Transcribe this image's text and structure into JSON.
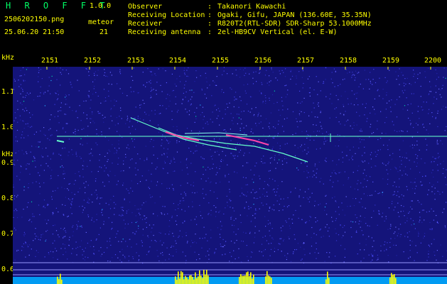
{
  "header": {
    "app_title": "H R O F F T",
    "app_version": "1.0.0",
    "filename": "2506202150.png",
    "datetime": "25.06.20 21:50",
    "meteor_label": "meteor",
    "meteor_count": "21"
  },
  "info": [
    {
      "key": "Observer",
      "value": "Takanori Kawachi"
    },
    {
      "key": "Receiving Location",
      "value": "Ogaki, Gifu, JAPAN (136.60E, 35.35N)"
    },
    {
      "key": "Receiver",
      "value": "R820T2(RTL-SDR) SDR-Sharp 53.1000MHz"
    },
    {
      "key": "Receiving antenna",
      "value": "2el-HB9CV Vertical (el. E-W)"
    }
  ],
  "axes": {
    "x_ticks": [
      "2151",
      "2152",
      "2153",
      "2154",
      "2155",
      "2156",
      "2157",
      "2158",
      "2159",
      "2200"
    ],
    "y_ticks": [
      "1.1",
      "1.0",
      "0.9",
      "0.8",
      "0.7",
      "0.6"
    ],
    "y_unit_top": "kHz",
    "y_unit_mid": "kHz"
  },
  "colors": {
    "background": "#000000",
    "noise_base": "#1a1a8c",
    "text_yellow": "#ffff00",
    "text_green": "#00ff66",
    "carrier": "#66ffcc",
    "meteor_hot": "#ff44aa",
    "meter_cyan": "#00ccff",
    "meter_yellow": "#ffff00"
  }
}
